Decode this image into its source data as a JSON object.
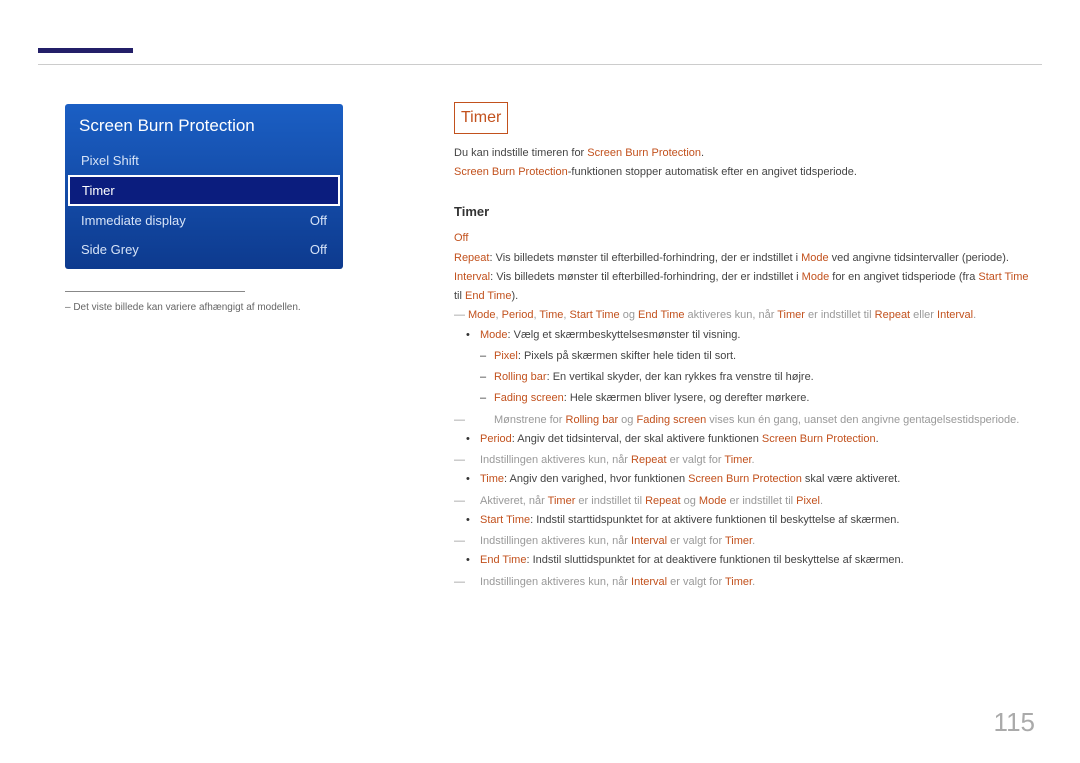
{
  "pageNumber": "115",
  "menu": {
    "title": "Screen Burn Protection",
    "items": [
      {
        "label": "Pixel Shift",
        "value": ""
      },
      {
        "label": "Timer",
        "value": ""
      },
      {
        "label": "Immediate display",
        "value": "Off"
      },
      {
        "label": "Side Grey",
        "value": "Off"
      }
    ]
  },
  "footnote": "– Det viste billede kan variere afhængigt af modellen.",
  "section": {
    "title": "Timer",
    "intro1a": "Du kan indstille timeren for ",
    "intro1b": "Screen Burn Protection",
    "intro1c": ".",
    "intro2a": "Screen Burn Protection",
    "intro2b": "-funktionen stopper automatisk efter en angivet tidsperiode.",
    "subTitle": "Timer",
    "off": "Off",
    "repeat": {
      "k": "Repeat",
      "t1": ": Vis billedets mønster til efterbilled-forhindring, der er indstillet i ",
      "k2": "Mode",
      "t2": " ved angivne tidsintervaller (periode)."
    },
    "interval": {
      "k": "Interval",
      "t1": ": Vis billedets mønster til efterbilled-forhindring, der er indstillet i ",
      "k2": "Mode",
      "t2": " for en angivet tidsperiode (fra ",
      "k3": "Start Time",
      "t3": " til ",
      "k4": "End Time",
      "t4": ")."
    },
    "note1": {
      "k1": "Mode",
      "c1": ", ",
      "k2": "Period",
      "c2": ", ",
      "k3": "Time",
      "c3": ", ",
      "k4": "Start Time",
      "c4": " og ",
      "k5": "End Time",
      "t1": " aktiveres kun, når ",
      "k6": "Timer",
      "t2": " er indstillet til ",
      "k7": "Repeat",
      "t3": " eller ",
      "k8": "Interval",
      "t4": "."
    },
    "modeItem": {
      "k": "Mode",
      "t": ": Vælg et skærmbeskyttelsesmønster til visning."
    },
    "pixelItem": {
      "k": "Pixel",
      "t": ": Pixels på skærmen skifter hele tiden til sort."
    },
    "rollingItem": {
      "k": "Rolling bar",
      "t": ": En vertikal skyder, der kan rykkes fra venstre til højre."
    },
    "fadingItem": {
      "k": "Fading screen",
      "t": ": Hele skærmen bliver lysere, og derefter mørkere."
    },
    "note2": {
      "t1": "Mønstrene for ",
      "k1": "Rolling bar",
      "t2": " og ",
      "k2": "Fading screen",
      "t3": " vises kun én gang, uanset den angivne gentagelsestidsperiode."
    },
    "periodItem": {
      "k": "Period",
      "t1": ": Angiv det tidsinterval, der skal aktivere funktionen ",
      "k2": "Screen Burn Protection",
      "t2": "."
    },
    "note3": {
      "t1": "Indstillingen aktiveres kun, når ",
      "k1": "Repeat",
      "t2": " er valgt for ",
      "k2": "Timer",
      "t3": "."
    },
    "timeItem": {
      "k": "Time",
      "t1": ": Angiv den varighed, hvor funktionen ",
      "k2": "Screen Burn Protection",
      "t2": " skal være aktiveret."
    },
    "note4": {
      "t1": "Aktiveret, når ",
      "k1": "Timer",
      "t2": " er indstillet til ",
      "k2": "Repeat",
      "t3": " og ",
      "k3": "Mode",
      "t4": " er indstillet til ",
      "k4": "Pixel",
      "t5": "."
    },
    "startItem": {
      "k": "Start Time",
      "t": ": Indstil starttidspunktet for at aktivere funktionen til beskyttelse af skærmen."
    },
    "note5": {
      "t1": "Indstillingen aktiveres kun, når ",
      "k1": "Interval",
      "t2": " er valgt for ",
      "k2": "Timer",
      "t3": "."
    },
    "endItem": {
      "k": "End Time",
      "t": ": Indstil sluttidspunktet for at deaktivere funktionen til beskyttelse af skærmen."
    },
    "note6": {
      "t1": "Indstillingen aktiveres kun, når ",
      "k1": "Interval",
      "t2": " er valgt for ",
      "k2": "Timer",
      "t3": "."
    }
  }
}
